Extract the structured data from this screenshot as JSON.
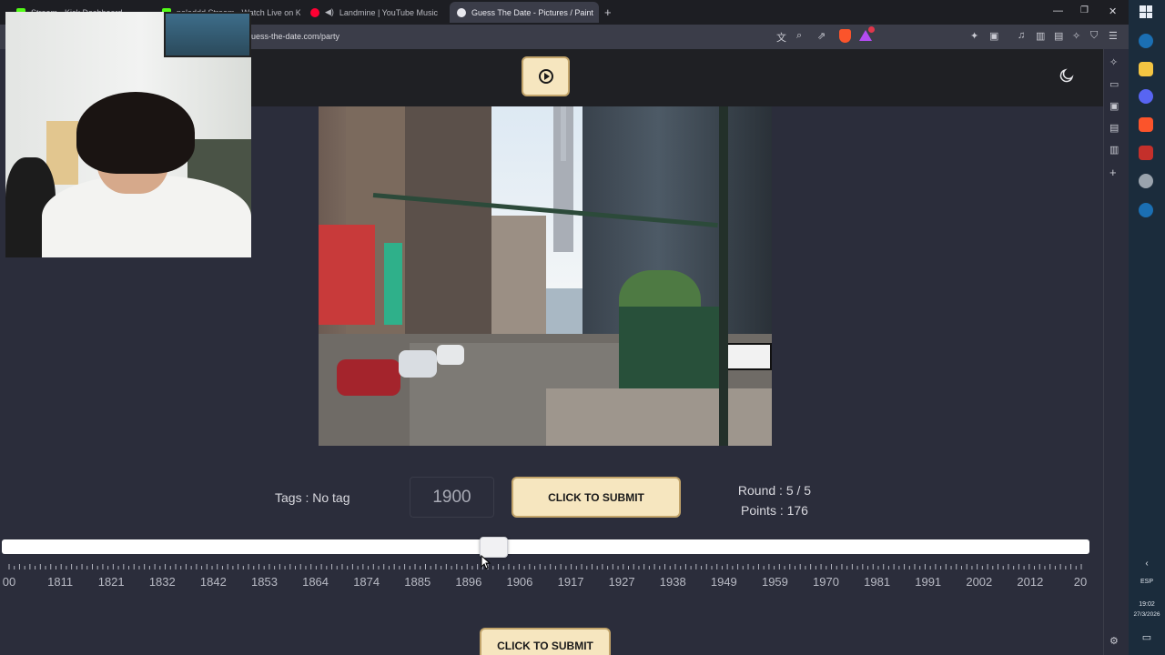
{
  "browser": {
    "tabs": [
      {
        "label": "Stream - Kick Dashboard",
        "favicon_color": "#53fc18",
        "active": false
      },
      {
        "label": "paladdd Stream - Watch Live on Kick",
        "favicon_color": "#53fc18",
        "active": false
      },
      {
        "label": "Landmine | YouTube Music",
        "favicon_color": "#ff0033",
        "active": false
      },
      {
        "label": "Guess The Date - Pictures / Paint",
        "favicon_color": "#e8e8ee",
        "active": true
      }
    ],
    "address": "uess-the-date.com/party"
  },
  "game": {
    "tags_text": "Tags : No tag",
    "year_value": "1900",
    "submit_label": "CLICK TO SUBMIT",
    "round_text": "Round : 5 / 5",
    "points_text": "Points : 176",
    "slider": {
      "min_year": 1800,
      "max_year": 2020,
      "current_year": 1900,
      "tick_labels": [
        "00",
        "1811",
        "1821",
        "1832",
        "1842",
        "1853",
        "1864",
        "1874",
        "1885",
        "1896",
        "1906",
        "1917",
        "1927",
        "1938",
        "1949",
        "1959",
        "1970",
        "1981",
        "1991",
        "2002",
        "2012",
        "20"
      ]
    },
    "bottom_submit_label": "CLICK TO SUBMIT"
  },
  "system": {
    "language": "ESP",
    "time": "19:02",
    "date": "27/3/2026"
  },
  "colors": {
    "accent_button": "#f6e6bf",
    "page_background": "#2b2d3b",
    "header_background": "#1f2024"
  }
}
